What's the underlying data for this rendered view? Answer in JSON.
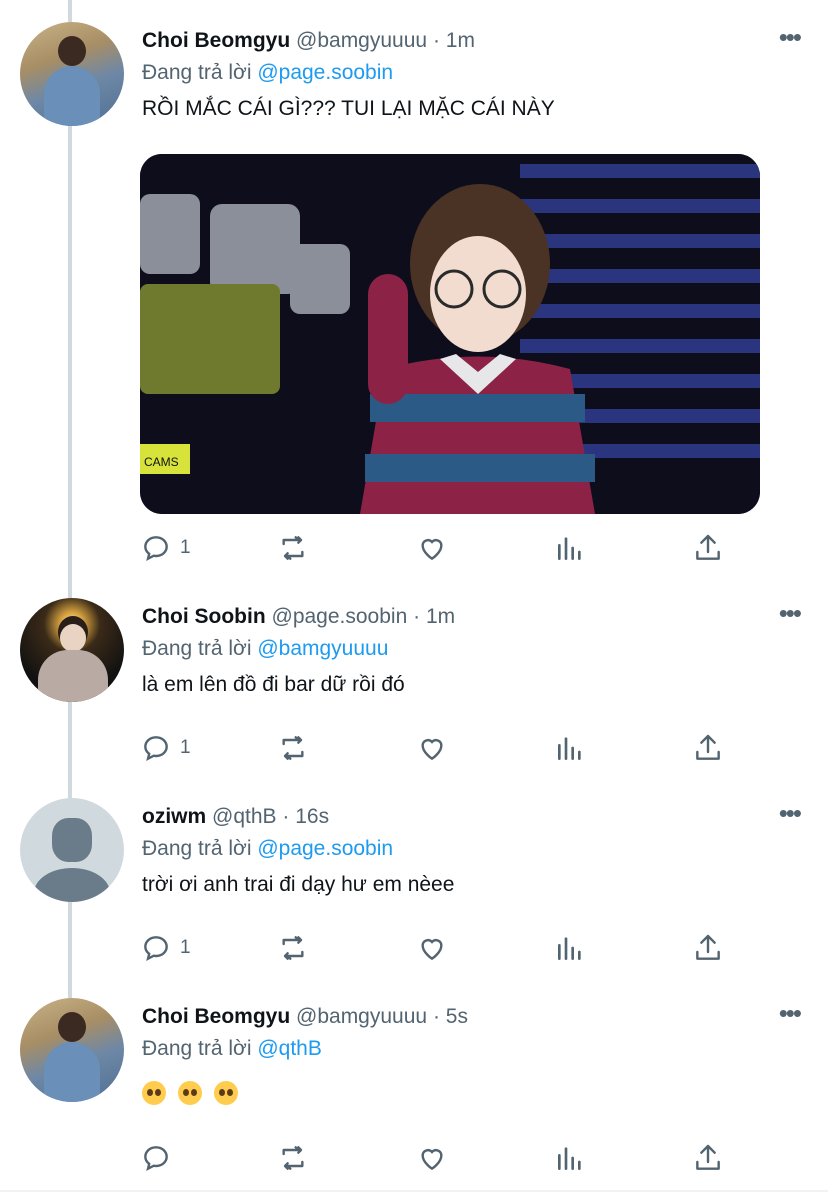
{
  "tweets": [
    {
      "name": "Choi Beomgyu",
      "handle": "@bamgyuuuu",
      "sep": "·",
      "time": "1m",
      "replying_prefix": "Đang trả lời",
      "replying_to": "@page.soobin",
      "text": "RỒI MẮC CÁI GÌ??? TUI LẠI MẶC CÁI NÀY",
      "reply_count": "1",
      "media_caption": "CAMS"
    },
    {
      "name": "Choi Soobin",
      "handle": "@page.soobin",
      "sep": "·",
      "time": "1m",
      "replying_prefix": "Đang trả lời",
      "replying_to": "@bamgyuuuu",
      "text": "là em lên đồ đi bar dữ rồi đó",
      "reply_count": "1"
    },
    {
      "name": "oziwm",
      "handle": "@qthB",
      "sep": "·",
      "time": "16s",
      "replying_prefix": "Đang trả lời",
      "replying_to": "@page.soobin",
      "text": "trời ơi anh trai đi dạy hư em nèee",
      "reply_count": "1"
    },
    {
      "name": "Choi Beomgyu",
      "handle": "@bamgyuuuu",
      "sep": "·",
      "time": "5s",
      "replying_prefix": "Đang trả lời",
      "replying_to": "@qthB",
      "text": "🥺🥺🥺",
      "reply_count": ""
    }
  ],
  "colors": {
    "accent": "#1d9bf0",
    "muted": "#536471",
    "thread_line": "#cfd9de"
  },
  "icons": [
    "more-icon",
    "reply-icon",
    "retweet-icon",
    "like-icon",
    "views-icon",
    "share-icon"
  ]
}
